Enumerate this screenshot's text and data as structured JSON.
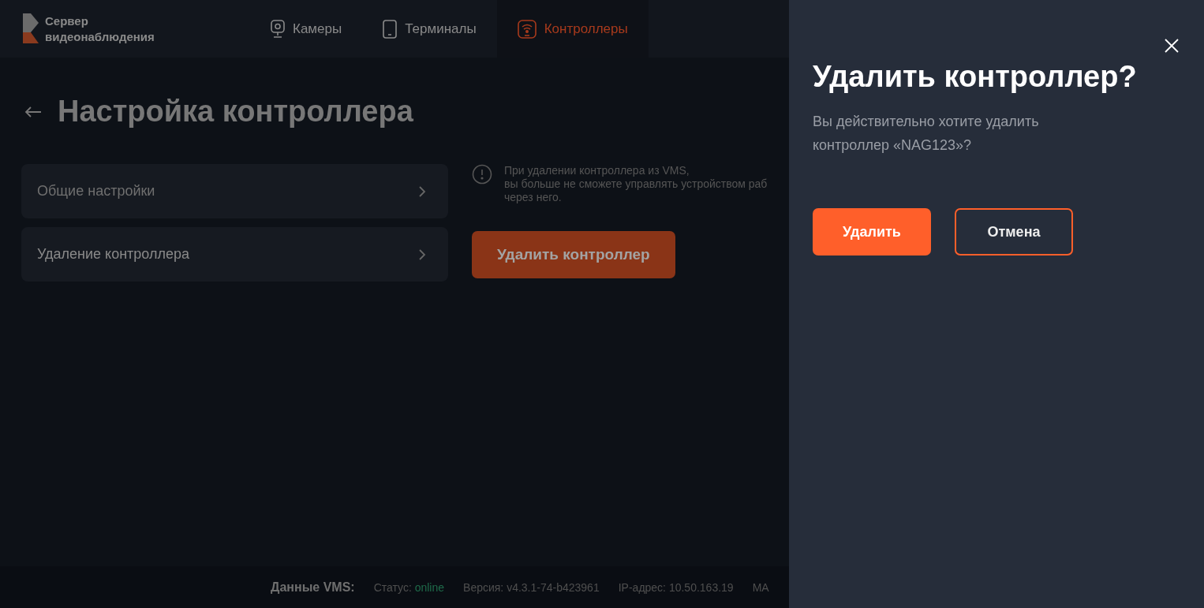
{
  "logo": {
    "line1": "Сервер",
    "line2": "видеонаблюдения"
  },
  "tabs": [
    {
      "label": "Камеры",
      "kind": "camera",
      "selected": false
    },
    {
      "label": "Терминалы",
      "kind": "tablet",
      "selected": false
    },
    {
      "label": "Контроллеры",
      "kind": "controller",
      "selected": true
    }
  ],
  "page": {
    "title": "Настройка контроллера"
  },
  "settings_menu": [
    {
      "label": "Общие настройки"
    },
    {
      "label": "Удаление контроллера"
    }
  ],
  "warning": {
    "lines": [
      "При удалении контроллера из VMS,",
      "вы больше не сможете управлять устройством раб",
      "через него."
    ]
  },
  "delete_button": "Удалить контроллер",
  "footer": {
    "label": "Данные VMS:",
    "items": [
      {
        "label": "Статус:",
        "value": "online",
        "kind": "status"
      },
      {
        "label": "Версия:",
        "value": "v4.3.1-74-b423961",
        "kind": "plain"
      },
      {
        "label": "IP-адрес:",
        "value": "10.50.163.19",
        "kind": "plain"
      },
      {
        "label": "MA",
        "kind": "plain"
      }
    ]
  },
  "dialog": {
    "title": "Удалить контроллер?",
    "message_lines": [
      "Вы действительно хотите удалить",
      "контроллер «NAG123»?"
    ],
    "confirm": "Удалить",
    "cancel": "Отмена"
  }
}
